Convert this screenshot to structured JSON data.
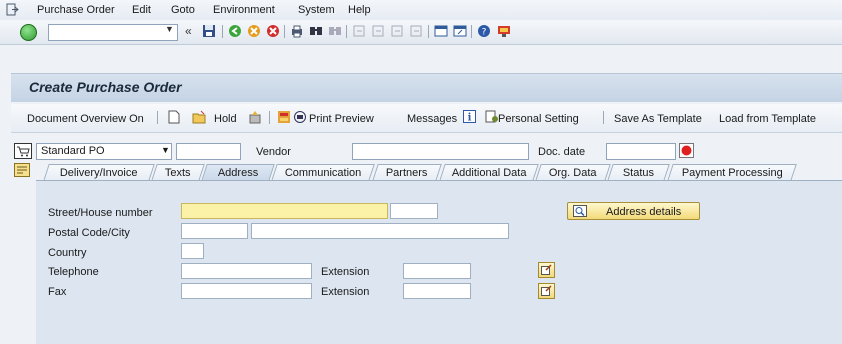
{
  "menu": {
    "items": [
      "Purchase Order",
      "Edit",
      "Goto",
      "Environment",
      "System",
      "Help"
    ]
  },
  "toolbar": {
    "command_value": "",
    "icons": [
      "ok-icon",
      "collapse-icon",
      "save-icon",
      "back-icon",
      "exit-icon",
      "cancel-icon",
      "print-icon",
      "find-icon",
      "find-next-icon",
      "first-page-icon",
      "prev-page-icon",
      "next-page-icon",
      "last-page-icon",
      "new-session-icon",
      "shortcut-icon",
      "help-icon",
      "customize-icon"
    ]
  },
  "title": "Create Purchase Order",
  "app_toolbar": {
    "doc_overview": "Document Overview On",
    "hold": "Hold",
    "print_preview": "Print Preview",
    "messages": "Messages",
    "personal_setting": "Personal Setting",
    "save_template": "Save As Template",
    "load_template": "Load from Template"
  },
  "header": {
    "doc_type": "Standard PO",
    "doc_number": "",
    "vendor_label": "Vendor",
    "vendor_value": "",
    "doc_date_label": "Doc. date",
    "doc_date_value": ""
  },
  "tabs": [
    "Delivery/Invoice",
    "Texts",
    "Address",
    "Communication",
    "Partners",
    "Additional Data",
    "Org. Data",
    "Status",
    "Payment Processing"
  ],
  "active_tab": "Address",
  "address": {
    "street_label": "Street/House number",
    "street_value": "",
    "house_value": "",
    "postal_label": "Postal Code/City",
    "postal_value": "",
    "city_value": "",
    "country_label": "Country",
    "country_value": "",
    "telephone_label": "Telephone",
    "telephone_value": "",
    "tel_ext_label": "Extension",
    "tel_ext_value": "",
    "fax_label": "Fax",
    "fax_value": "",
    "fax_ext_label": "Extension",
    "fax_ext_value": "",
    "address_details": "Address details"
  }
}
